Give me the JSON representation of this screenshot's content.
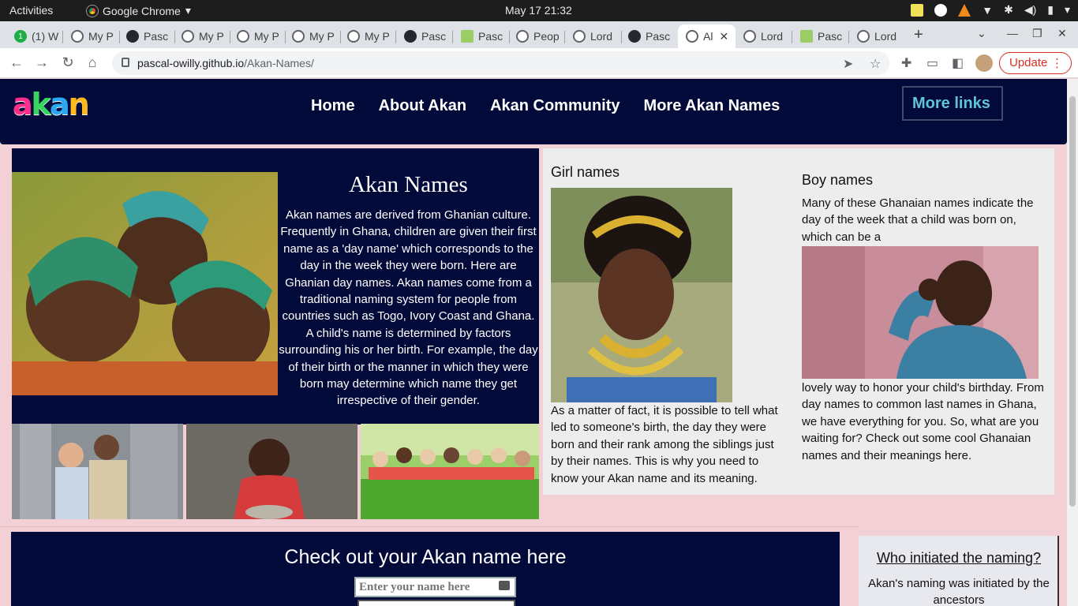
{
  "system_bar": {
    "activities": "Activities",
    "app_name": "Google Chrome",
    "clock": "May 17  21:32"
  },
  "tabs": [
    {
      "label": "(1) W",
      "icon": "whatsapp-icon"
    },
    {
      "label": "My P",
      "icon": "globe-icon"
    },
    {
      "label": "Pasc",
      "icon": "github-icon"
    },
    {
      "label": "My P",
      "icon": "globe-icon"
    },
    {
      "label": "My P",
      "icon": "globe-icon"
    },
    {
      "label": "My P",
      "icon": "globe-icon"
    },
    {
      "label": "My P",
      "icon": "globe-icon"
    },
    {
      "label": "Pasc",
      "icon": "github-icon"
    },
    {
      "label": "Pasc",
      "icon": "green-square-icon"
    },
    {
      "label": "Peop",
      "icon": "globe-icon"
    },
    {
      "label": "Lord",
      "icon": "globe-icon"
    },
    {
      "label": "Pasc",
      "icon": "github-icon"
    },
    {
      "label": "Al",
      "icon": "globe-icon",
      "active": true
    },
    {
      "label": "Lord",
      "icon": "globe-icon"
    },
    {
      "label": "Pasc",
      "icon": "green-square-icon"
    },
    {
      "label": "Lord",
      "icon": "globe-icon"
    }
  ],
  "toolbar": {
    "url_host": "pascal-owilly.github.io",
    "url_path": "/Akan-Names/",
    "update_label": "Update"
  },
  "site": {
    "logo": {
      "letters": [
        "a",
        "k",
        "a",
        "n"
      ],
      "colors": [
        "#ff2d8a",
        "#36d65c",
        "#2aa8f2",
        "#ffb81c"
      ]
    },
    "nav": [
      "Home",
      "About Akan",
      "Akan Community",
      "More Akan Names"
    ],
    "more_links": "More links",
    "hero": {
      "title": "Akan Names",
      "text": "Akan names are derived from Ghanian culture. Frequently in Ghana, children are given their first name as a 'day name' which corresponds to the day in the week they were born. Here are Ghanian day names. Akan names come from a traditional naming system for people from countries such as Togo, Ivory Coast and Ghana. A child's name is determined by factors surrounding his or her birth. For example, the day of their birth or the manner in which they were born may determine which name they get irrespective of their gender."
    },
    "girl": {
      "title": "Girl names",
      "text": "As a matter of fact, it is possible to tell what led to someone's birth, the day they were born and their rank among the siblings just by their names. This is why you need to know your Akan name and its meaning."
    },
    "boy": {
      "title": "Boy names",
      "text1": "Many of these Ghanaian names indicate the day of the week that a child was born on, which can be a",
      "text2": "lovely way to honor your child's birthday. From day names to common last names in Ghana, we have everything for you. So, what are you waiting for? Check out some cool Ghanaian names and their meanings here."
    },
    "check": {
      "title": "Check out your Akan name here",
      "placeholder": "Enter your name here"
    },
    "who": {
      "title": "Who initiated the naming?",
      "text": "Akan's naming was initiated by the ancestors"
    }
  },
  "colors": {
    "page_bg": "#f2d0d5",
    "navy": "#020a3a",
    "panel_bg": "#ededed",
    "link_cyan": "#60c3d8",
    "update_red": "#d93025"
  }
}
